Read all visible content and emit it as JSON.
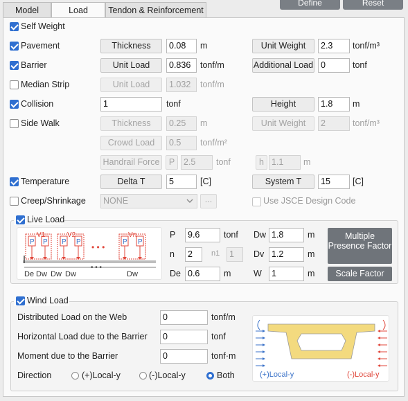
{
  "top_buttons": {
    "define": "Define",
    "reset": "Reset"
  },
  "tabs": [
    "Model",
    "Load",
    "Tendon & Reinforcement"
  ],
  "self_weight": {
    "label": "Self Weight",
    "checked": true
  },
  "pavement": {
    "label": "Pavement",
    "checked": true,
    "btn1": "Thickness",
    "val1": "0.08",
    "unit1": "m",
    "btn2": "Unit Weight",
    "val2": "2.3",
    "unit2": "tonf/m³"
  },
  "barrier": {
    "label": "Barrier",
    "checked": true,
    "btn1": "Unit Load",
    "val1": "0.836",
    "unit1": "tonf/m",
    "btn2": "Additional Load",
    "val2": "0",
    "unit2": "tonf"
  },
  "median_strip": {
    "label": "Median Strip",
    "checked": false,
    "btn1": "Unit Load",
    "val1": "1.032",
    "unit1": "tonf/m"
  },
  "collision": {
    "label": "Collision",
    "checked": true,
    "val1": "1",
    "unit1": "tonf",
    "btn2": "Height",
    "val2": "1.8",
    "unit2": "m"
  },
  "side_walk": {
    "label": "Side Walk",
    "checked": false,
    "btn1": "Thickness",
    "val1": "0.25",
    "unit1": "m",
    "btn2": "Unit Weight",
    "val2": "2",
    "unit2": "tonf/m³",
    "btn3": "Crowd Load",
    "val3": "0.5",
    "unit3": "tonf/m²",
    "btn4": "Handrail Force",
    "p_label": "P",
    "val4": "2.5",
    "unit4": "tonf",
    "h_label": "h",
    "val5": "1.1",
    "unit5": "m"
  },
  "temperature": {
    "label": "Temperature",
    "checked": true,
    "btn1": "Delta T",
    "val1": "5",
    "unit1": "[C]",
    "btn2": "System T",
    "val2": "15",
    "unit2": "[C]"
  },
  "creep": {
    "label": "Creep/Shrinkage",
    "checked": false,
    "select": "NONE",
    "ellipsis": "...",
    "jsce_label": "Use JSCE Design Code"
  },
  "live_load": {
    "label": "Live Load",
    "checked": true,
    "P": {
      "label": "P",
      "value": "9.6",
      "unit": "tonf"
    },
    "n": {
      "label": "n",
      "value": "2"
    },
    "n1": {
      "label": "n1",
      "value": "1"
    },
    "De": {
      "label": "De",
      "value": "0.6",
      "unit": "m"
    },
    "Dw": {
      "label": "Dw",
      "value": "1.8",
      "unit": "m"
    },
    "Dv": {
      "label": "Dv",
      "value": "1.2",
      "unit": "m"
    },
    "W": {
      "label": "W",
      "value": "1",
      "unit": "m"
    },
    "multiple_presence": "Multiple Presence Factor",
    "scale_factor": "Scale Factor",
    "diagram": {
      "v1": "V1",
      "v2": "V2",
      "vn": "Vn",
      "p": "P",
      "dots": "• • •",
      "bottom": [
        "De",
        "Dw",
        "Dw",
        "Dw",
        "Dw"
      ]
    }
  },
  "wind_load": {
    "label": "Wind Load",
    "checked": true,
    "rows": [
      {
        "label": "Distributed Load on the Web",
        "value": "0",
        "unit": "tonf/m"
      },
      {
        "label": "Horizontal Load due to the Barrier",
        "value": "0",
        "unit": "tonf"
      },
      {
        "label": "Moment due to the Barrier",
        "value": "0",
        "unit": "tonf·m"
      }
    ],
    "direction_label": "Direction",
    "options": [
      {
        "label": "(+)Local-y",
        "selected": false
      },
      {
        "label": "(-)Local-y",
        "selected": false
      },
      {
        "label": "Both",
        "selected": true
      }
    ],
    "diagram": {
      "plus": "(+)Local-y",
      "minus": "(-)Local-y"
    }
  },
  "colors": {
    "accent": "#2f6fd0",
    "load_red": "#e0463a",
    "wind_blue": "#3a72c8",
    "girder": "#f3da7f"
  }
}
